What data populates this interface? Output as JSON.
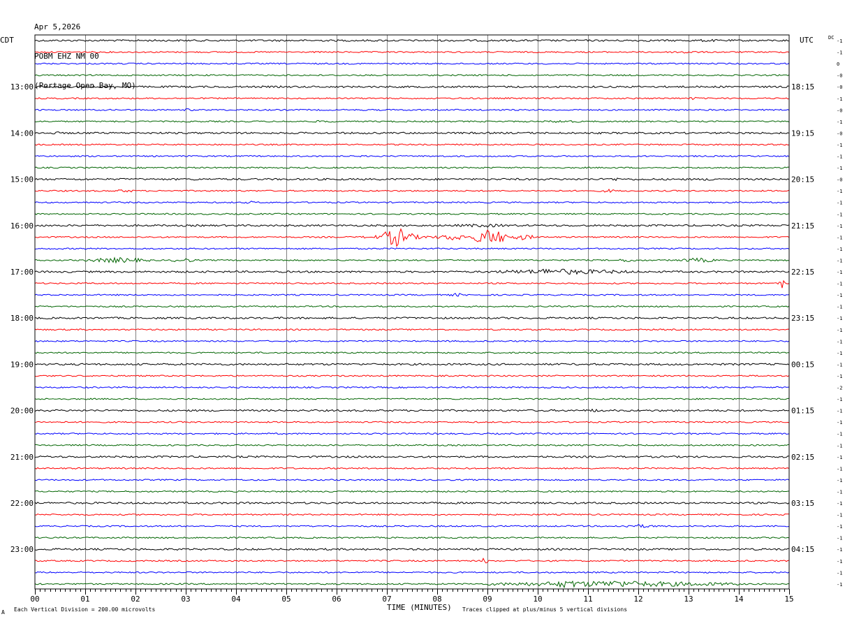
{
  "header": {
    "date": "Apr 5,2026",
    "station": "POBM EHZ NM 00",
    "location": "(Portage Open Bay, MO)"
  },
  "left_tz": "CDT",
  "right_tz": "UTC",
  "dc_label": "DC",
  "footer": {
    "scale_note": "Each Vertical Division =  200.00 microvolts",
    "clip_note": "Traces clipped at plus/minus 5 vertical divisions",
    "mark": "A"
  },
  "trace_colors": [
    "#000000",
    "#ff0000",
    "#0000ff",
    "#006400"
  ],
  "chart_data": {
    "type": "line",
    "title": "POBM EHZ NM 00",
    "xlabel": "TIME (MINUTES)",
    "ylabel": "",
    "xlim": [
      0,
      15
    ],
    "x_ticks": [
      "00",
      "01",
      "02",
      "03",
      "04",
      "05",
      "06",
      "07",
      "08",
      "09",
      "10",
      "11",
      "12",
      "13",
      "14",
      "15"
    ],
    "minutes_per_trace": 15,
    "trace_count": 48,
    "left_hour_labels": [
      "13:00",
      "14:00",
      "15:00",
      "16:00",
      "17:00",
      "18:00",
      "19:00",
      "20:00",
      "21:00",
      "22:00",
      "23:00"
    ],
    "right_hour_labels": [
      "18:15",
      "19:15",
      "20:15",
      "21:15",
      "22:15",
      "23:15",
      "00:15",
      "01:15",
      "02:15",
      "03:15",
      "04:15"
    ],
    "dc_offsets": [
      "-1",
      "-1",
      "0",
      "-0",
      "-0",
      "-1",
      "-0",
      "-1",
      "-0",
      "-1",
      "-1",
      "-1",
      "-0",
      "-1",
      "-1",
      "-1",
      "-1",
      "-1",
      "-1",
      "-1",
      "-1",
      "-1",
      "-1",
      "-1",
      "-1",
      "-1",
      "-1",
      "-1",
      "-1",
      "-1",
      "-2",
      "-1",
      "-1",
      "-1",
      "-1",
      "-1",
      "-1",
      "-1",
      "-1",
      "-1",
      "-1",
      "-1",
      "-1",
      "-1",
      "-1",
      "-1",
      "-1",
      "-1"
    ],
    "events": [
      {
        "trace": 0,
        "start": 13.0,
        "end": 13.8,
        "amp": 2
      },
      {
        "trace": 1,
        "start": 12.6,
        "end": 13.2,
        "amp": 2.5
      },
      {
        "trace": 5,
        "start": 12.9,
        "end": 13.3,
        "amp": 2
      },
      {
        "trace": 6,
        "start": 2.9,
        "end": 3.2,
        "amp": 2
      },
      {
        "trace": 7,
        "start": 5.5,
        "end": 6.0,
        "amp": 2
      },
      {
        "trace": 7,
        "start": 10.0,
        "end": 11.0,
        "amp": 2
      },
      {
        "trace": 8,
        "start": 0.2,
        "end": 0.6,
        "amp": 2
      },
      {
        "trace": 12,
        "start": 11.2,
        "end": 11.8,
        "amp": 2.5
      },
      {
        "trace": 12,
        "start": 13.2,
        "end": 13.8,
        "amp": 2.5
      },
      {
        "trace": 13,
        "start": 1.6,
        "end": 2.0,
        "amp": 2.5
      },
      {
        "trace": 13,
        "start": 11.2,
        "end": 11.6,
        "amp": 2.5
      },
      {
        "trace": 14,
        "start": 4.1,
        "end": 4.5,
        "amp": 2
      },
      {
        "trace": 16,
        "start": 8.0,
        "end": 9.8,
        "amp": 2.5
      },
      {
        "trace": 17,
        "start": 6.9,
        "end": 7.5,
        "amp": 14
      },
      {
        "trace": 17,
        "start": 6.5,
        "end": 8.0,
        "amp": 4
      },
      {
        "trace": 17,
        "start": 8.0,
        "end": 8.7,
        "amp": 5
      },
      {
        "trace": 17,
        "start": 8.7,
        "end": 9.4,
        "amp": 12
      },
      {
        "trace": 17,
        "start": 9.4,
        "end": 10.0,
        "amp": 4
      },
      {
        "trace": 19,
        "start": 1.0,
        "end": 2.3,
        "amp": 4
      },
      {
        "trace": 19,
        "start": 2.7,
        "end": 3.2,
        "amp": 3.5
      },
      {
        "trace": 19,
        "start": 11.6,
        "end": 12.0,
        "amp": 3
      },
      {
        "trace": 19,
        "start": 12.8,
        "end": 13.6,
        "amp": 3.5
      },
      {
        "trace": 20,
        "start": 9.0,
        "end": 12.0,
        "amp": 4
      },
      {
        "trace": 20,
        "start": 10.0,
        "end": 10.4,
        "amp": 5.5
      },
      {
        "trace": 21,
        "start": 14.8,
        "end": 14.9,
        "amp": 8
      },
      {
        "trace": 22,
        "start": 8.2,
        "end": 8.6,
        "amp": 2.5
      },
      {
        "trace": 32,
        "start": 11.0,
        "end": 11.3,
        "amp": 3
      },
      {
        "trace": 42,
        "start": 11.5,
        "end": 12.5,
        "amp": 2.5
      },
      {
        "trace": 45,
        "start": 8.9,
        "end": 9.0,
        "amp": 7
      },
      {
        "trace": 47,
        "start": 9.0,
        "end": 14.0,
        "amp": 4.5
      },
      {
        "trace": 47,
        "start": 10.2,
        "end": 11.0,
        "amp": 6
      },
      {
        "trace": 47,
        "start": 11.2,
        "end": 12.0,
        "amp": 5.5
      }
    ]
  }
}
